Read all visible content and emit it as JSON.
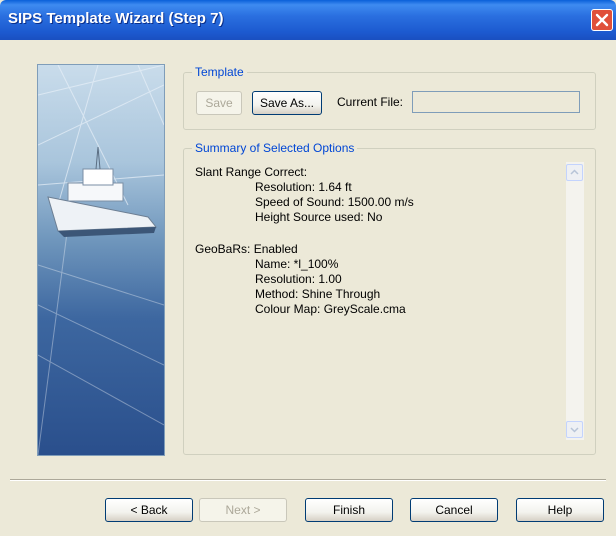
{
  "window": {
    "title": "SIPS Template Wizard (Step 7)"
  },
  "template": {
    "legend": "Template",
    "save_label": "Save",
    "save_as_label": "Save As...",
    "current_file_label": "Current File:",
    "current_file_value": ""
  },
  "summary": {
    "legend": "Summary of Selected Options",
    "lines": [
      "Slant Range Correct:",
      "Resolution: 1.64 ft",
      "Speed of Sound: 1500.00 m/s",
      "Height Source used: No",
      "GeoBaRs: Enabled",
      "Name: *l_100%",
      "Resolution: 1.00",
      "Method: Shine Through",
      "Colour Map: GreyScale.cma"
    ]
  },
  "buttons": {
    "back": "< Back",
    "next": "Next >",
    "finish": "Finish",
    "cancel": "Cancel",
    "help": "Help"
  }
}
